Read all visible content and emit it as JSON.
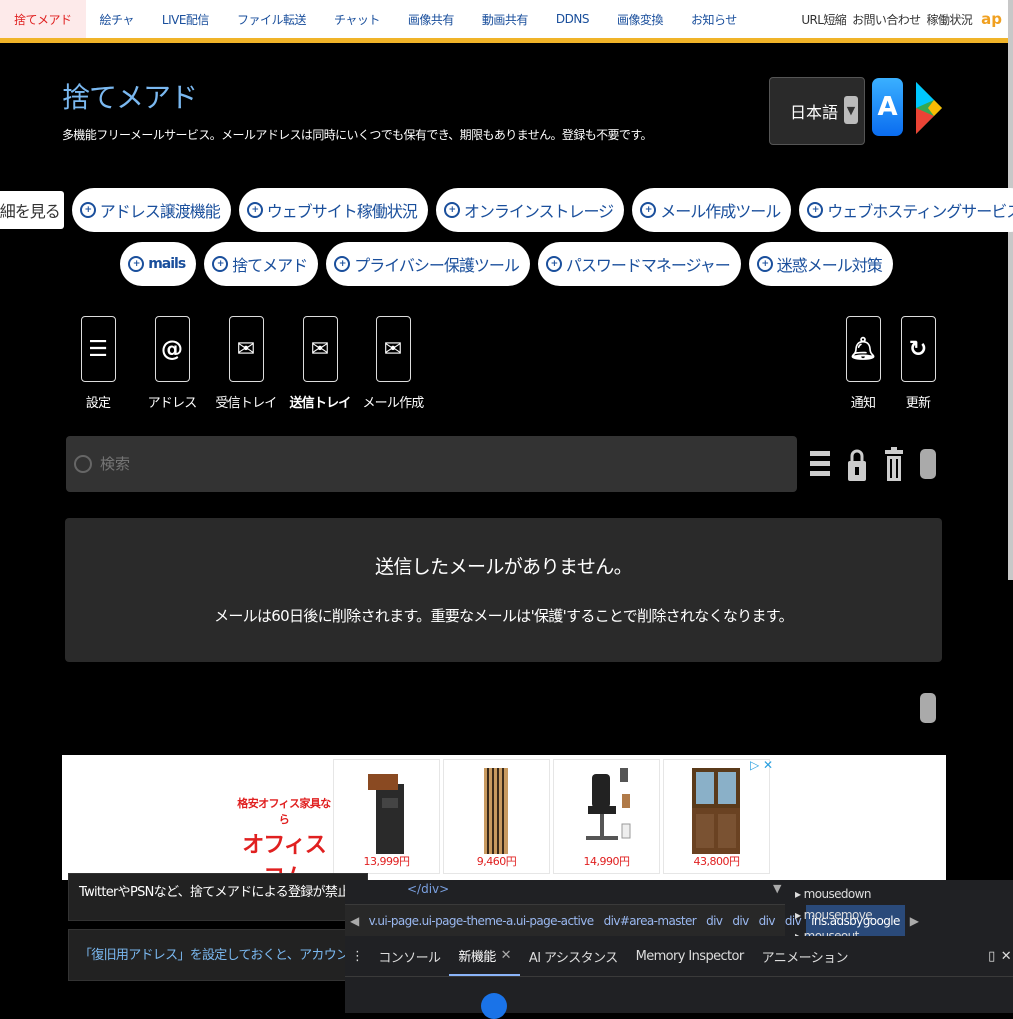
{
  "topnav": {
    "items": [
      "捨てメアド",
      "絵チャ",
      "LIVE配信",
      "ファイル転送",
      "チャット",
      "画像共有",
      "動画共有",
      "DDNS",
      "画像変換",
      "お知らせ"
    ],
    "right": [
      "URL短縮",
      "お問い合わせ",
      "稼働状況"
    ],
    "logo": "ap"
  },
  "header": {
    "title": "捨てメアド",
    "subtitle": "多機能フリーメールサービス。メールアドレスは同時にいくつでも保有でき、期限もありません。登録も不要です。"
  },
  "language": {
    "value": "日本語"
  },
  "tags": {
    "details": "詳細を見る",
    "row1": [
      "アドレス譲渡機能",
      "ウェブサイト稼働状況",
      "オンラインストレージ",
      "メール作成ツール",
      "ウェブホスティングサービス"
    ],
    "row2": [
      "mails",
      "捨てメアド",
      "プライバシー保護ツール",
      "パスワードマネージャー",
      "迷惑メール対策"
    ]
  },
  "tools": {
    "settings": "設定",
    "address": "アドレス",
    "inbox": "受信トレイ",
    "sent": "送信トレイ",
    "compose": "メール作成",
    "notify": "通知",
    "refresh": "更新"
  },
  "search": {
    "placeholder": "検索"
  },
  "panel": {
    "message": "送信したメールがありません。",
    "note": "メールは60日後に削除されます。重要なメールは'保護'することで削除されなくなります。"
  },
  "ad": {
    "brand_small": "格安オフィス家具なら",
    "brand_big": "オフィスコム",
    "prices": [
      "13,999円",
      "9,460円",
      "14,990円",
      "43,800円"
    ]
  },
  "info": {
    "line1": "TwitterやPSNなど、捨てメアドによる登録が禁止されていたり、登",
    "line2": "「復旧用アドレス」を設定しておくと、アカウントにアクセスでき"
  },
  "devtools": {
    "code": "</div>",
    "breadcrumbs": [
      "v.ui-page.ui-page-theme-a.ui-page-active",
      "div#area-master",
      "div",
      "div",
      "div",
      "div",
      "ins.adsbygoogle"
    ],
    "events": [
      "mousedown",
      "mousemove",
      "mouseout"
    ],
    "tabs": [
      "コンソール",
      "新機能",
      "AI アシスタンス",
      "Memory Inspector",
      "アニメーション"
    ]
  }
}
